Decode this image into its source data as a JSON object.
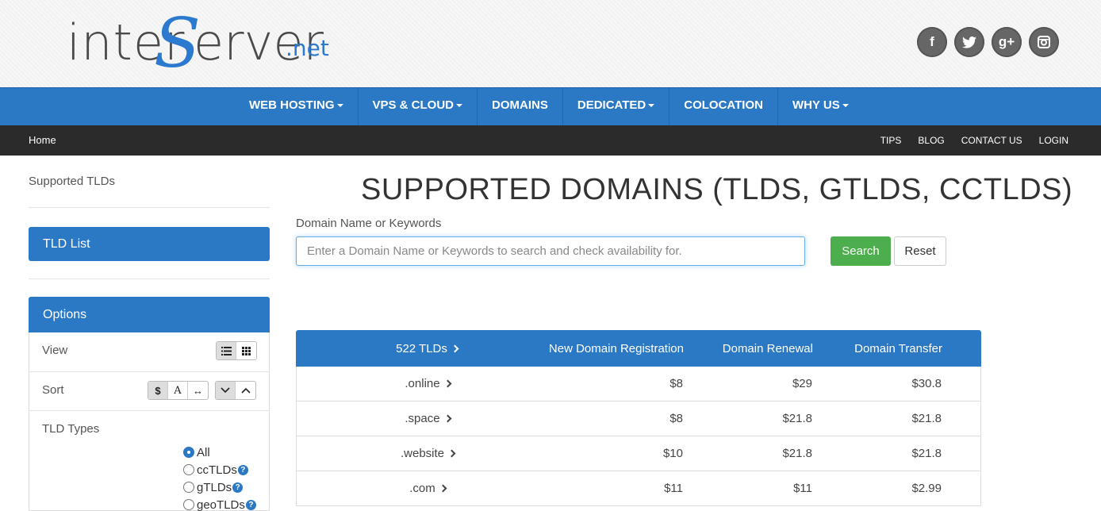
{
  "header": {
    "logo": {
      "part1": "inter",
      "part2": "S",
      "part3": "erver",
      "part4": ".net"
    },
    "social": [
      "f",
      "t",
      "g+",
      "ig"
    ]
  },
  "main_nav": [
    {
      "label": "WEB HOSTING",
      "dropdown": true
    },
    {
      "label": "VPS & CLOUD",
      "dropdown": true
    },
    {
      "label": "DOMAINS",
      "dropdown": false
    },
    {
      "label": "DEDICATED",
      "dropdown": true
    },
    {
      "label": "COLOCATION",
      "dropdown": false
    },
    {
      "label": "WHY US",
      "dropdown": true
    }
  ],
  "sub_nav": {
    "home": "Home",
    "links": [
      "TIPS",
      "BLOG",
      "CONTACT US",
      "LOGIN"
    ]
  },
  "sidebar": {
    "title": "Supported TLDs",
    "tld_list_label": "TLD List",
    "options_label": "Options",
    "view_label": "View",
    "sort_label": "Sort",
    "sort_buttons": [
      "$",
      "A",
      "↔"
    ],
    "tld_types_label": "TLD Types",
    "tld_types": [
      {
        "label": "All",
        "selected": true,
        "help": false
      },
      {
        "label": "ccTLDs",
        "selected": false,
        "help": true
      },
      {
        "label": "gTLDs",
        "selected": false,
        "help": true
      },
      {
        "label": "geoTLDs",
        "selected": false,
        "help": true
      }
    ]
  },
  "main": {
    "title": "SUPPORTED DOMAINS (TLDS, GTLDS, CCTLDS)",
    "search_label": "Domain Name or Keywords",
    "search_placeholder": "Enter a Domain Name or Keywords to search and check availability for.",
    "search_button": "Search",
    "reset_button": "Reset"
  },
  "table": {
    "headers": [
      "522 TLDs",
      "New Domain Registration",
      "Domain Renewal",
      "Domain Transfer"
    ],
    "rows": [
      {
        "tld": ".online",
        "registration": "$8",
        "renewal": "$29",
        "transfer": "$30.8"
      },
      {
        "tld": ".space",
        "registration": "$8",
        "renewal": "$21.8",
        "transfer": "$21.8"
      },
      {
        "tld": ".website",
        "registration": "$10",
        "renewal": "$21.8",
        "transfer": "$21.8"
      },
      {
        "tld": ".com",
        "registration": "$11",
        "renewal": "$11",
        "transfer": "$2.99"
      }
    ]
  },
  "colors": {
    "brand_blue": "#2b78c5",
    "dark_bar": "#2b2b2b",
    "search_green": "#4cae4c"
  }
}
